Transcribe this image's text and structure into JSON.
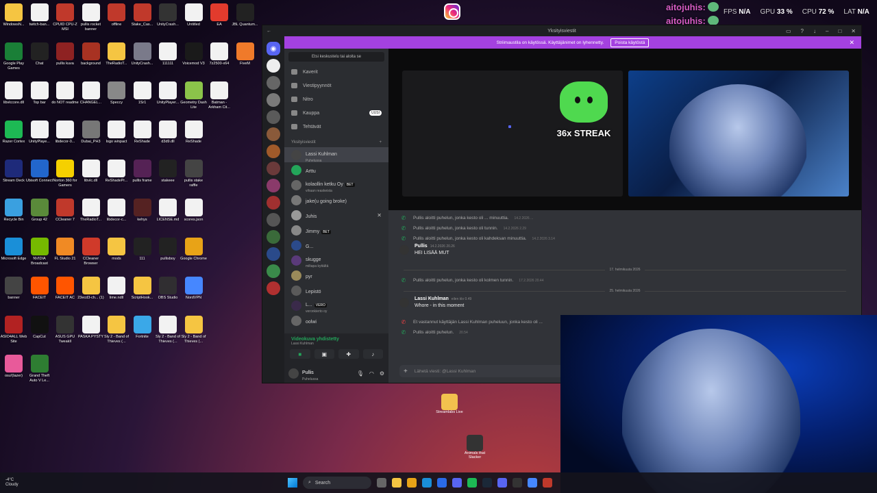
{
  "desktop": {
    "icons": [
      {
        "label": "WindowsN...",
        "color": "#f5c542"
      },
      {
        "label": "twitch-ban...",
        "color": "#f2f2f2"
      },
      {
        "label": "CPUID CPU-Z MSI",
        "color": "#c0392b"
      },
      {
        "label": "pullis rocket banner",
        "color": "#f2f2f2"
      },
      {
        "label": "offline",
        "color": "#c0392b"
      },
      {
        "label": "Stake_Cas...",
        "color": "#c0392b"
      },
      {
        "label": "UnityCrash...",
        "color": "#333333"
      },
      {
        "label": "Untitled",
        "color": "#f2f2f2"
      },
      {
        "label": "EA",
        "color": "#e23b2d"
      },
      {
        "label": "JBL Quantum...",
        "color": "#222222"
      },
      {
        "label": "Google Play Games",
        "color": "#1a7f37"
      },
      {
        "label": "Chat",
        "color": "#222222"
      },
      {
        "label": "pullis kuva",
        "color": "#8e2222"
      },
      {
        "label": "background",
        "color": "#a83222"
      },
      {
        "label": "TheRadioT...",
        "color": "#f5c542"
      },
      {
        "label": "UnityCrash...",
        "color": "#7a7a8a"
      },
      {
        "label": "111111",
        "color": "#f2f2f2"
      },
      {
        "label": "Voicemod V3",
        "color": "#1a1a1a"
      },
      {
        "label": "7z2500-x64",
        "color": "#f2f2f2"
      },
      {
        "label": "FiveM",
        "color": "#f07a2a"
      },
      {
        "label": "libvlccore.dll",
        "color": "#f2f2f2"
      },
      {
        "label": "Top bar",
        "color": "#f2f2f2"
      },
      {
        "label": "do NOT readme",
        "color": "#f2f2f2"
      },
      {
        "label": "CHANGEL...",
        "color": "#f2f2f2"
      },
      {
        "label": "Speccy",
        "color": "#888888"
      },
      {
        "label": "1Sr1",
        "color": "#f2f2f2"
      },
      {
        "label": "UnityPlayer...",
        "color": "#f2f2f2"
      },
      {
        "label": "Geometry Dash Lite",
        "color": "#8bc34a"
      },
      {
        "label": "Batman - Arkham Cit...",
        "color": "#f2f2f2"
      },
      {
        "label": "Razer Cortex",
        "color": "#1db954"
      },
      {
        "label": "UnityPlaye...",
        "color": "#f2f2f2"
      },
      {
        "label": "libdecor-0...",
        "color": "#f2f2f2"
      },
      {
        "label": "Dubai_PH3",
        "color": "#777777"
      },
      {
        "label": "logo winpact",
        "color": "#f2f2f2"
      },
      {
        "label": "ReShade",
        "color": "#f2f2f2"
      },
      {
        "label": "d3d9.dll",
        "color": "#f2f2f2"
      },
      {
        "label": "ReShade",
        "color": "#f2f2f2"
      },
      {
        "label": "Stream Deck",
        "color": "#1e2a7a"
      },
      {
        "label": "Ubisoft Connect",
        "color": "#2266cc"
      },
      {
        "label": "Norton 360 for Gamers",
        "color": "#f5d000"
      },
      {
        "label": "libvlc.dll",
        "color": "#f2f2f2"
      },
      {
        "label": "ReShadePr...",
        "color": "#f2f2f2"
      },
      {
        "label": "pullis frame",
        "color": "#552255"
      },
      {
        "label": "stakeee",
        "color": "#222222"
      },
      {
        "label": "pullis stake raffle",
        "color": "#444444"
      },
      {
        "label": "Recycle Bin",
        "color": "#3aa0e0"
      },
      {
        "label": "Group 42",
        "color": "#5a8a3a"
      },
      {
        "label": "CCleaner 7",
        "color": "#c0392b"
      },
      {
        "label": "TheRadioT...",
        "color": "#f2f2f2"
      },
      {
        "label": "libdecor-c...",
        "color": "#f2f2f2"
      },
      {
        "label": "kehys",
        "color": "#552222"
      },
      {
        "label": "LICENSE.md",
        "color": "#f2f2f2"
      },
      {
        "label": "scores.json",
        "color": "#f2f2f2"
      },
      {
        "label": "Microsoft Edge",
        "color": "#1a8fd8"
      },
      {
        "label": "NVIDIA Broadcast",
        "color": "#76b900"
      },
      {
        "label": "FL Studio 21",
        "color": "#f08a24"
      },
      {
        "label": "CCleaner Browser",
        "color": "#d03a2a"
      },
      {
        "label": "mods",
        "color": "#f5c542"
      },
      {
        "label": "111",
        "color": "#222222"
      },
      {
        "label": "pullisboy",
        "color": "#222222"
      },
      {
        "label": "Google Chrome",
        "color": "#e8a317"
      },
      {
        "label": "banner",
        "color": "#444444"
      },
      {
        "label": "FACEIT",
        "color": "#ff5500"
      },
      {
        "label": "FACEIT AC",
        "color": "#ff5500"
      },
      {
        "label": "23ecd3-ch... (1)",
        "color": "#f5c542"
      },
      {
        "label": "lime.ndll",
        "color": "#f2f2f2"
      },
      {
        "label": "ScriptHook...",
        "color": "#f5c542"
      },
      {
        "label": "OBS Studio",
        "color": "#302e31"
      },
      {
        "label": "NordVPN",
        "color": "#4687ff"
      },
      {
        "label": "ASIO4ALL Web Site",
        "color": "#b22222"
      },
      {
        "label": "CapCut",
        "color": "#111111"
      },
      {
        "label": "ASUS GPU TweakII",
        "color": "#333333"
      },
      {
        "label": "PASKA PYSTY",
        "color": "#f2f2f2"
      },
      {
        "label": "Sly 2 - Band of Thieves (...",
        "color": "#f5c542"
      },
      {
        "label": "Fortnite",
        "color": "#3aa8e8"
      },
      {
        "label": "Sly 2 - Band of Thieves (...",
        "color": "#f2f2f2"
      },
      {
        "label": "Sly 2 - Band of Thieves (...",
        "color": "#f5c542"
      },
      {
        "label": "osu!(lazer)",
        "color": "#e85a9a"
      },
      {
        "label": "Grand Theft Auto V Le...",
        "color": "#2e7d32"
      }
    ],
    "center_icons": [
      {
        "label": "Streamlabs Live",
        "color": "#f2c14e"
      },
      {
        "label": "Animals that Slacker",
        "color": "#333333"
      }
    ]
  },
  "overlay": {
    "chat_lines": [
      "aitojuhis:",
      "aitojuhis:",
      "aitojuhis:",
      "aitojuhis:"
    ],
    "stats": {
      "fps_label": "FPS",
      "fps": "N/A",
      "gpu_label": "GPU",
      "gpu": "33 %",
      "cpu_label": "CPU",
      "cpu": "72 %",
      "lat_label": "LAT",
      "lat": "N/A"
    }
  },
  "discord": {
    "title": "Yksityisviestit",
    "banner_text": "Striimaustila on käytössä. Käyttäjänimet on lyhennetty.",
    "banner_button": "Poista käytöstä",
    "search_placeholder": "Etsi keskustelu tai aloita se",
    "nav": [
      {
        "label": "Kaverit"
      },
      {
        "label": "Viestipyynnöt"
      },
      {
        "label": "Nitro"
      },
      {
        "label": "Kauppa",
        "badge": "UUSI"
      },
      {
        "label": "Tehtävät"
      }
    ],
    "dm_header": "Yksityisviestit",
    "dms": [
      {
        "name": "Lassi Kuhlman",
        "sub": "Puhelussa",
        "color": "#444"
      },
      {
        "name": "Arttu",
        "sub": "",
        "color": "#23a55a"
      },
      {
        "name": "kolaollin ketku Oy",
        "tag": "BET",
        "sub": "vihaan reaskeista",
        "color": "#666"
      },
      {
        "name": "jake(u going broke)",
        "sub": "",
        "color": "#777"
      },
      {
        "name": "Juhis",
        "sub": "",
        "color": "#999"
      },
      {
        "name": "Jimmy",
        "tag": "BET",
        "sub": "",
        "color": "#888"
      },
      {
        "name": "G...",
        "sub": "",
        "color": "#2b4a8a"
      },
      {
        "name": "skugge",
        "sub": "miltapa kyttältä",
        "color": "#5a3a7a"
      },
      {
        "name": "pyr",
        "sub": "",
        "color": "#9a8a5a"
      },
      {
        "name": "Lepistö",
        "sub": "",
        "color": "#5a5a5a"
      },
      {
        "name": "L...",
        "tag": "VERO",
        "sub": "veronkierto oy",
        "color": "#3a2a4a"
      },
      {
        "name": "oolwi",
        "sub": "",
        "color": "#666"
      }
    ],
    "voice": {
      "status": "Videokuva yhdistetty",
      "channel": "Lassi Kuhlman"
    },
    "user": {
      "name": "Pullis",
      "status": "Puhelussa"
    },
    "call": {
      "streak_text": "36x STREAK"
    },
    "messages": [
      {
        "type": "call",
        "text": "Pullis aloitti puhelun, jonka kesto oli ... minuuttia.",
        "time": "14.2.2026 ..."
      },
      {
        "type": "call",
        "text": "Pullis aloitti puhelun, jonka kesto oli tunnin.",
        "time": "14.2.2026 2.29"
      },
      {
        "type": "call",
        "text": "Pullis aloitti puhelun, jonka kesto oli kahdeksan minuuttia.",
        "time": "14.2.2026 3.14"
      },
      {
        "type": "msg",
        "author": "Pullis",
        "time": "14.2.2026 20.26",
        "text": "HEI LISÄÄ MUT"
      },
      {
        "type": "date",
        "text": "17. helmikuuta 2026"
      },
      {
        "type": "call",
        "text": "Pullis aloitti puhelun, jonka kesto oli kolmen tunnin.",
        "time": "17.2.2026 20.44"
      },
      {
        "type": "date",
        "text": "25. helmikuuta 2026"
      },
      {
        "type": "msg",
        "author": "Lassi Kuhlman",
        "time": "eilen klo 0.49",
        "text": "Whore - in this moment"
      },
      {
        "type": "missed",
        "text": "Et vastannut käyttäjän Lassi Kuhlman puheluun, jonka kesto oli ...",
        "time": ""
      },
      {
        "type": "call",
        "text": "Pullis aloitti puhelun.",
        "time": "20.54"
      }
    ],
    "compose_placeholder": "Lähetä viesti: @Lassi Kuhlman"
  },
  "taskbar": {
    "weather_temp": "-4°C",
    "weather_desc": "Cloudy",
    "search_label": "Search"
  }
}
